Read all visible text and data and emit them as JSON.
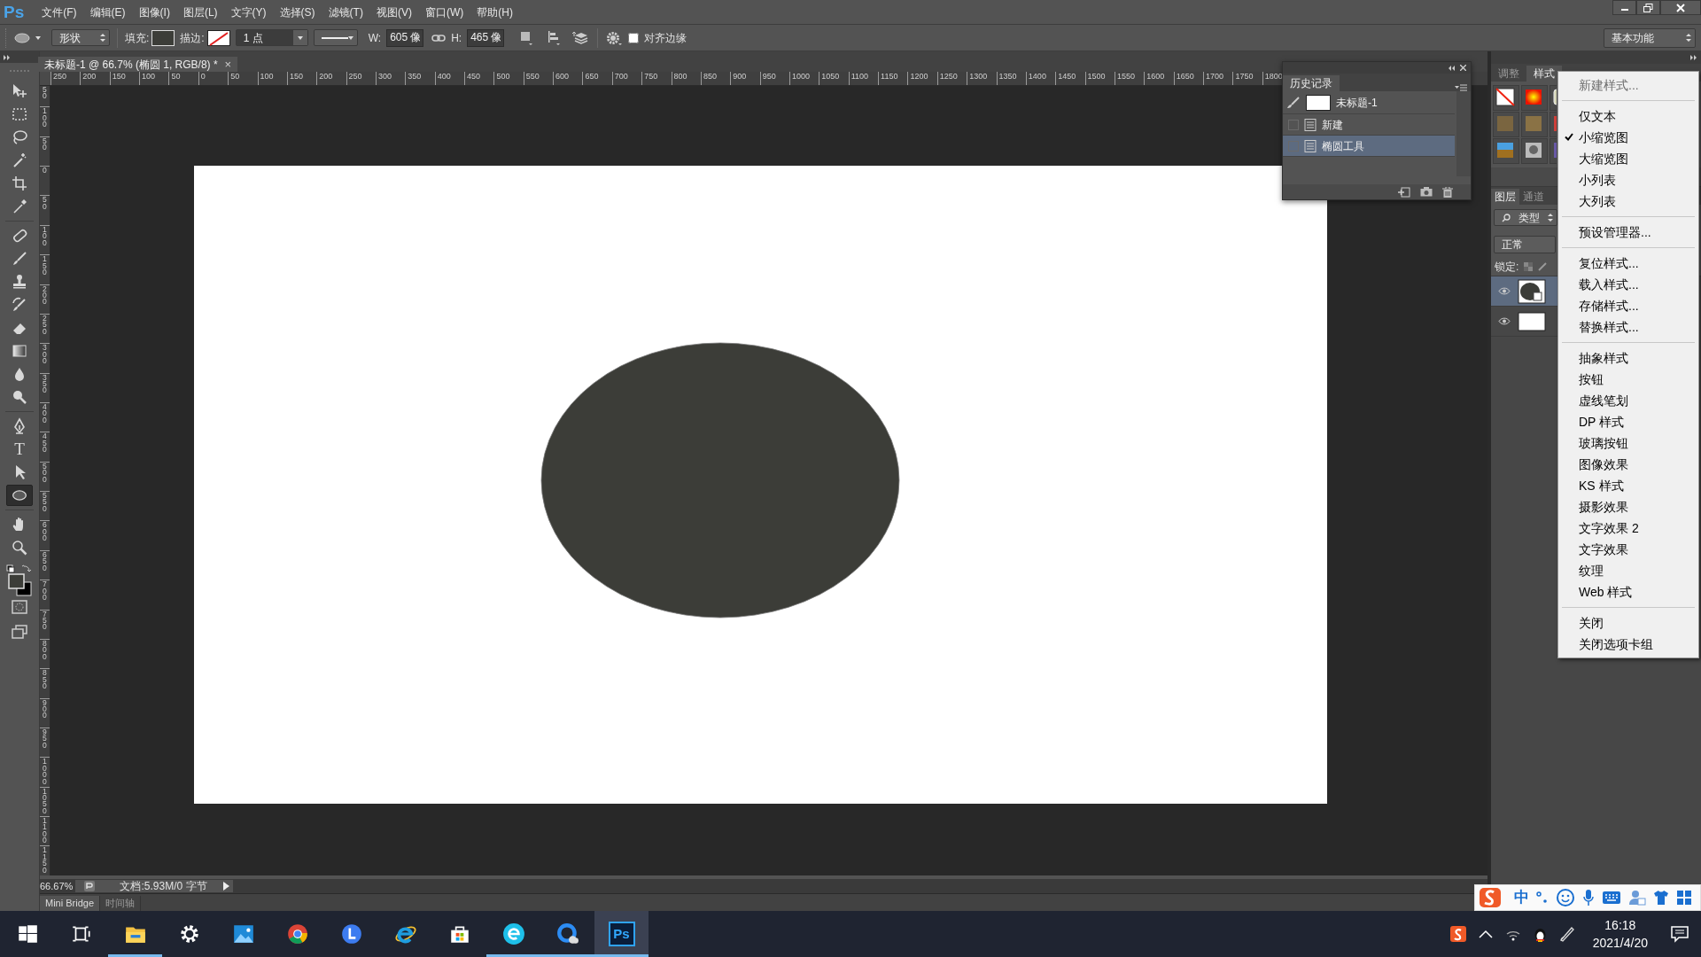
{
  "app_logo": "Ps",
  "menu": [
    "文件(F)",
    "编辑(E)",
    "图像(I)",
    "图层(L)",
    "文字(Y)",
    "选择(S)",
    "滤镜(T)",
    "视图(V)",
    "窗口(W)",
    "帮助(H)"
  ],
  "options_bar": {
    "mode": "形状",
    "fill_label": "填充:",
    "stroke_label": "描边:",
    "stroke_width": "1 点",
    "w_label": "W:",
    "w_value": "605 像",
    "h_label": "H:",
    "h_value": "465 像",
    "align_edges": {
      "label": "对齐边缘",
      "checked": false
    },
    "workspace": "基本功能"
  },
  "document_tab": {
    "title": "未标题-1 @ 66.7% (椭圆 1, RGB/8) *",
    "close": "×"
  },
  "horizontal_ruler": [
    "250",
    "200",
    "150",
    "100",
    "50",
    "0",
    "50",
    "100",
    "150",
    "200",
    "250",
    "300",
    "350",
    "400",
    "450",
    "500",
    "550",
    "600",
    "650",
    "700",
    "750",
    "800",
    "850",
    "900",
    "950",
    "1000",
    "1050",
    "1100",
    "1150",
    "1200",
    "1250",
    "1300",
    "1350",
    "1400",
    "1450",
    "1500",
    "1550",
    "1600",
    "1650",
    "1700",
    "1750",
    "1800"
  ],
  "vertical_ruler": [
    "50",
    "100",
    "50",
    "0",
    "50",
    "100",
    "150",
    "200",
    "250",
    "300",
    "350",
    "400",
    "450",
    "500",
    "550",
    "600",
    "650",
    "700",
    "750",
    "800",
    "850",
    "900",
    "950",
    "1000",
    "1050",
    "1100",
    "1150"
  ],
  "tools": [
    {
      "kind": "move",
      "selected": false
    },
    {
      "kind": "marquee",
      "selected": false
    },
    {
      "kind": "lasso",
      "selected": false
    },
    {
      "kind": "magic-wand",
      "selected": false
    },
    {
      "kind": "crop",
      "selected": false
    },
    {
      "kind": "eyedropper",
      "selected": false
    },
    {
      "kind": "healing",
      "selected": false
    },
    {
      "kind": "brush",
      "selected": false
    },
    {
      "kind": "stamp",
      "selected": false
    },
    {
      "kind": "history-brush",
      "selected": false
    },
    {
      "kind": "eraser",
      "selected": false
    },
    {
      "kind": "gradient",
      "selected": false
    },
    {
      "kind": "blur",
      "selected": false
    },
    {
      "kind": "dodge",
      "selected": false
    },
    {
      "kind": "pen",
      "selected": false
    },
    {
      "kind": "type",
      "glyph": "T",
      "selected": false
    },
    {
      "kind": "path-select",
      "selected": false
    },
    {
      "kind": "ellipse",
      "selected": true
    },
    {
      "kind": "hand",
      "selected": false
    },
    {
      "kind": "zoom",
      "selected": false
    }
  ],
  "status_bar": {
    "zoom": "66.67%",
    "doc_info": "文档:5.93M/0 字节"
  },
  "bottom_tabs": [
    {
      "label": "Mini Bridge",
      "selected": true
    },
    {
      "label": "时间轴",
      "selected": false
    }
  ],
  "history_panel": {
    "title": "历史记录",
    "snapshot": "未标题-1",
    "states": [
      {
        "label": "新建",
        "selected": false
      },
      {
        "label": "椭圆工具",
        "selected": true
      }
    ]
  },
  "styles_tabs": [
    {
      "label": "调整",
      "selected": false
    },
    {
      "label": "样式",
      "selected": true
    }
  ],
  "layers_panel": {
    "tabs": [
      {
        "label": "图层",
        "selected": true
      },
      {
        "label": "通道",
        "selected": false
      }
    ],
    "filter": "类型",
    "blend_mode": "正常",
    "lock_label": "锁定:",
    "layers": [
      {
        "kind": "shape",
        "selected": true,
        "visible": true
      },
      {
        "kind": "background",
        "selected": false,
        "visible": true
      }
    ]
  },
  "styles_menu": [
    {
      "kind": "item",
      "label": "新建样式...",
      "disabled": true,
      "checked": false
    },
    {
      "kind": "separator"
    },
    {
      "kind": "item",
      "label": "仅文本",
      "disabled": false,
      "checked": false
    },
    {
      "kind": "item",
      "label": "小缩览图",
      "disabled": false,
      "checked": true
    },
    {
      "kind": "item",
      "label": "大缩览图",
      "disabled": false,
      "checked": false
    },
    {
      "kind": "item",
      "label": "小列表",
      "disabled": false,
      "checked": false
    },
    {
      "kind": "item",
      "label": "大列表",
      "disabled": false,
      "checked": false
    },
    {
      "kind": "separator"
    },
    {
      "kind": "item",
      "label": "预设管理器...",
      "disabled": false,
      "checked": false
    },
    {
      "kind": "separator"
    },
    {
      "kind": "item",
      "label": "复位样式...",
      "disabled": false,
      "checked": false
    },
    {
      "kind": "item",
      "label": "载入样式...",
      "disabled": false,
      "checked": false
    },
    {
      "kind": "item",
      "label": "存储样式...",
      "disabled": false,
      "checked": false
    },
    {
      "kind": "item",
      "label": "替换样式...",
      "disabled": false,
      "checked": false
    },
    {
      "kind": "separator"
    },
    {
      "kind": "item",
      "label": "抽象样式",
      "disabled": false,
      "checked": false
    },
    {
      "kind": "item",
      "label": "按钮",
      "disabled": false,
      "checked": false
    },
    {
      "kind": "item",
      "label": "虚线笔划",
      "disabled": false,
      "checked": false
    },
    {
      "kind": "item",
      "label": "DP 样式",
      "disabled": false,
      "checked": false
    },
    {
      "kind": "item",
      "label": "玻璃按钮",
      "disabled": false,
      "checked": false
    },
    {
      "kind": "item",
      "label": "图像效果",
      "disabled": false,
      "checked": false
    },
    {
      "kind": "item",
      "label": "KS 样式",
      "disabled": false,
      "checked": false
    },
    {
      "kind": "item",
      "label": "摄影效果",
      "disabled": false,
      "checked": false
    },
    {
      "kind": "item",
      "label": "文字效果 2",
      "disabled": false,
      "checked": false
    },
    {
      "kind": "item",
      "label": "文字效果",
      "disabled": false,
      "checked": false
    },
    {
      "kind": "item",
      "label": "纹理",
      "disabled": false,
      "checked": false
    },
    {
      "kind": "item",
      "label": "Web 样式",
      "disabled": false,
      "checked": false
    },
    {
      "kind": "separator"
    },
    {
      "kind": "item",
      "label": "关闭",
      "disabled": false,
      "checked": false
    },
    {
      "kind": "item",
      "label": "关闭选项卡组",
      "disabled": false,
      "checked": false
    }
  ],
  "taskbar": {
    "apps": [
      {
        "kind": "start",
        "running": false,
        "active": false
      },
      {
        "kind": "task-view",
        "running": false,
        "active": false
      },
      {
        "kind": "file-explorer",
        "running": true,
        "active": false
      },
      {
        "kind": "settings",
        "running": false,
        "active": false
      },
      {
        "kind": "photos",
        "running": false,
        "active": false
      },
      {
        "kind": "chrome",
        "running": false,
        "active": false
      },
      {
        "kind": "l-app",
        "running": false,
        "active": false
      },
      {
        "kind": "ie",
        "running": false,
        "active": false
      },
      {
        "kind": "store",
        "running": false,
        "active": false
      },
      {
        "kind": "e-app",
        "running": true,
        "active": false
      },
      {
        "kind": "q-app",
        "running": true,
        "active": false
      },
      {
        "kind": "photoshop",
        "label": "Ps",
        "running": true,
        "active": true
      }
    ],
    "ime_mode": "中",
    "time": "16:18",
    "date": "2021/4/20"
  }
}
